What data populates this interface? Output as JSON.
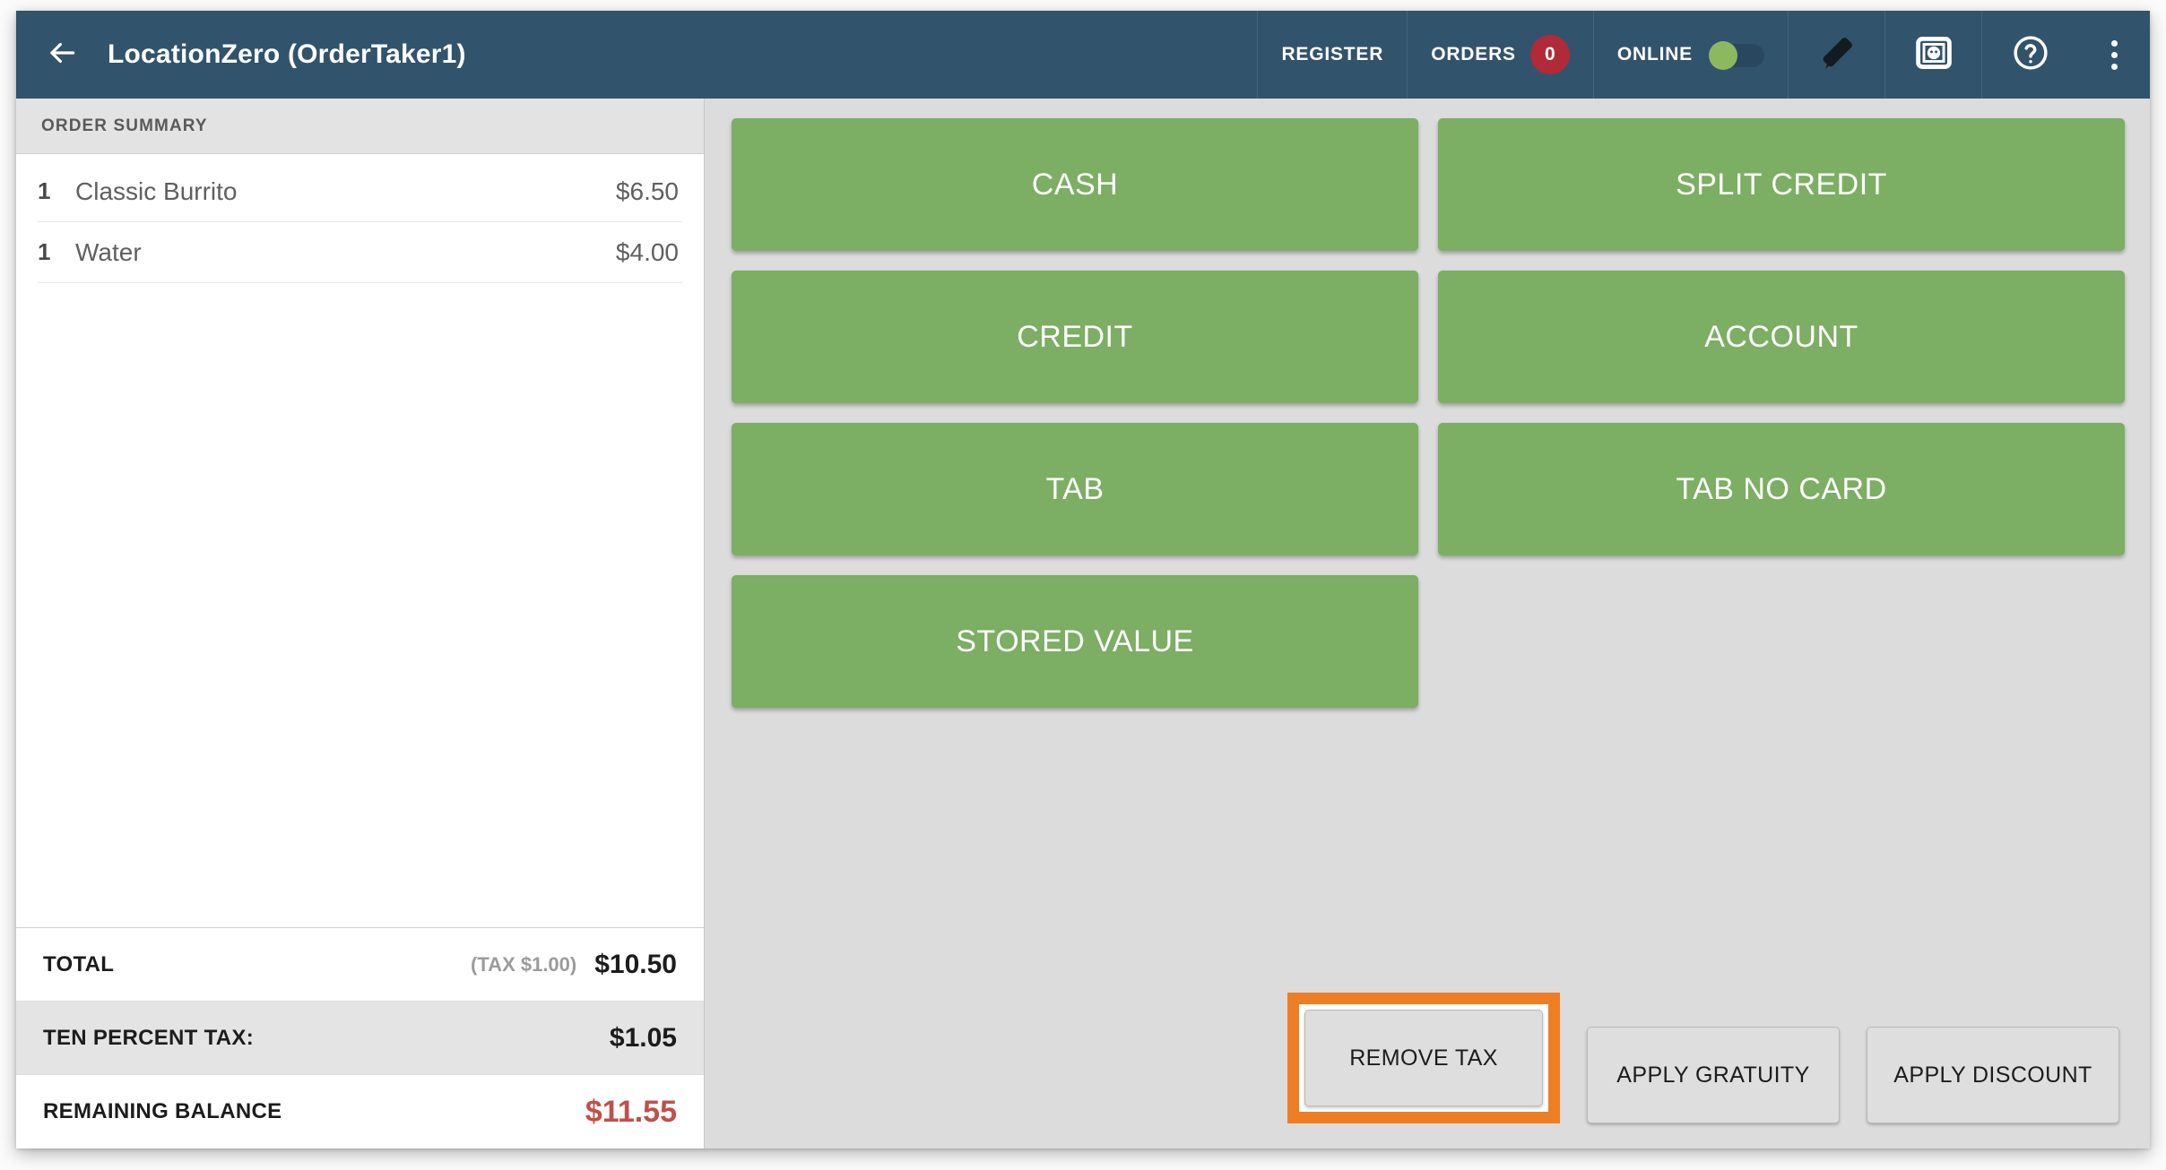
{
  "header": {
    "back_icon": "arrow-left-icon",
    "title": "LocationZero (OrderTaker1)",
    "register_label": "REGISTER",
    "orders_label": "ORDERS",
    "orders_count": "0",
    "online_label": "ONLINE",
    "online_toggle_state": "on",
    "tag_icon": "tag-icon",
    "face_frame_icon": "customer-face-icon",
    "help_icon": "help-circle-icon",
    "overflow_icon": "more-vertical-icon",
    "bg_color": "#32536c",
    "badge_color": "#b02a37",
    "toggle_on_color": "#8cb860"
  },
  "sidebar": {
    "summary_title": "ORDER SUMMARY",
    "items": [
      {
        "qty": "1",
        "name": "Classic Burrito",
        "price": "$6.50"
      },
      {
        "qty": "1",
        "name": "Water",
        "price": "$4.00"
      }
    ],
    "totals": [
      {
        "label": "TOTAL",
        "sub": "(TAX $1.00)",
        "value": "$10.50",
        "alt": false,
        "danger": false
      },
      {
        "label": "TEN PERCENT TAX:",
        "sub": "",
        "value": "$1.05",
        "alt": true,
        "danger": false
      },
      {
        "label": "REMAINING BALANCE",
        "sub": "",
        "value": "$11.55",
        "alt": false,
        "danger": true
      }
    ],
    "danger_color": "#c0504a"
  },
  "main": {
    "payment_buttons": [
      {
        "label": "CASH"
      },
      {
        "label": "SPLIT CREDIT"
      },
      {
        "label": "CREDIT"
      },
      {
        "label": "ACCOUNT"
      },
      {
        "label": "TAB"
      },
      {
        "label": "TAB NO CARD"
      },
      {
        "label": "STORED VALUE"
      }
    ],
    "payment_button_color": "#7cae63",
    "actions": [
      {
        "label": "REMOVE TAX",
        "highlighted": true
      },
      {
        "label": "APPLY GRATUITY",
        "highlighted": false
      },
      {
        "label": "APPLY DISCOUNT",
        "highlighted": false
      }
    ],
    "highlight_color": "#ee7e24"
  }
}
